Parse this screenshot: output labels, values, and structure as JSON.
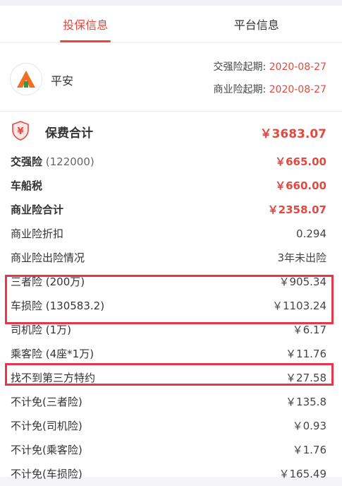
{
  "tabs": [
    {
      "label": "投保信息",
      "active": true
    },
    {
      "label": "平台信息",
      "active": false
    }
  ],
  "insurer": {
    "name": "平安",
    "compulsory_start_label": "交强险起期:",
    "compulsory_start_value": "2020-08-27",
    "commercial_start_label": "商业险起期:",
    "commercial_start_value": "2020-08-27"
  },
  "total": {
    "label": "保费合计",
    "value": "￥3683.07",
    "icon": "yen-shield-icon"
  },
  "rows": [
    {
      "label": "交强险",
      "sub": " (122000)",
      "value": "￥665.00",
      "bold": true
    },
    {
      "label": "车船税",
      "sub": "",
      "value": "￥660.00",
      "bold": true
    },
    {
      "label": "商业险合计",
      "sub": "",
      "value": "￥2358.07",
      "bold": true
    },
    {
      "label": "商业险折扣",
      "sub": "",
      "value": "0.294",
      "bold": false
    },
    {
      "label": "商业险出险情况",
      "sub": "",
      "value": "3年未出险",
      "bold": false
    },
    {
      "label": "三者险 (200万)",
      "sub": "",
      "value": "￥905.34",
      "bold": false
    },
    {
      "label": "车损险 (130583.2)",
      "sub": "",
      "value": "￥1103.24",
      "bold": false
    },
    {
      "label": "司机险 (1万)",
      "sub": "",
      "value": "￥6.17",
      "bold": false
    },
    {
      "label": "乘客险 (4座*1万)",
      "sub": "",
      "value": "￥11.76",
      "bold": false
    },
    {
      "label": "找不到第三方特约",
      "sub": "",
      "value": "￥27.58",
      "bold": false
    },
    {
      "label": "不计免(三者险)",
      "sub": "",
      "value": "￥135.8",
      "bold": false
    },
    {
      "label": "不计免(司机险)",
      "sub": "",
      "value": "￥0.93",
      "bold": false
    },
    {
      "label": "不计免(乘客险)",
      "sub": "",
      "value": "￥1.76",
      "bold": false
    },
    {
      "label": "不计免(车损险)",
      "sub": "",
      "value": "￥165.49",
      "bold": false
    }
  ],
  "colors": {
    "accent": "#e5483f",
    "highlight_border": "#e5364a",
    "logo_orange": "#f36f21",
    "logo_green": "#2a9d49"
  }
}
